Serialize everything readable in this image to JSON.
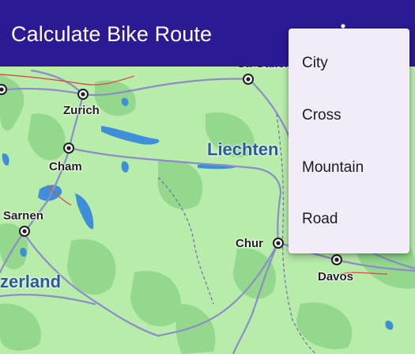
{
  "app_bar": {
    "title": "Calculate Bike Route",
    "overflow_icon": "more-vert-icon",
    "background_color": "#2b1a91"
  },
  "route_type_menu": {
    "items": [
      {
        "label": "City"
      },
      {
        "label": "Cross"
      },
      {
        "label": "Mountain"
      },
      {
        "label": "Road"
      }
    ],
    "background_color": "#f1ecf8"
  },
  "map": {
    "cities": [
      {
        "name": "Zurich"
      },
      {
        "name": "Cham"
      },
      {
        "name": "Sarnen"
      },
      {
        "name": "Chur"
      },
      {
        "name": "Davos"
      },
      {
        "name": "St. Gallen"
      }
    ],
    "regions": [
      {
        "name": "Liechten"
      },
      {
        "name": "zerland"
      }
    ],
    "land_color": "#b8ecaa",
    "forest_color": "#8fd68a",
    "water_color": "#3f8fd8",
    "road_color": "#8c8cc9"
  }
}
